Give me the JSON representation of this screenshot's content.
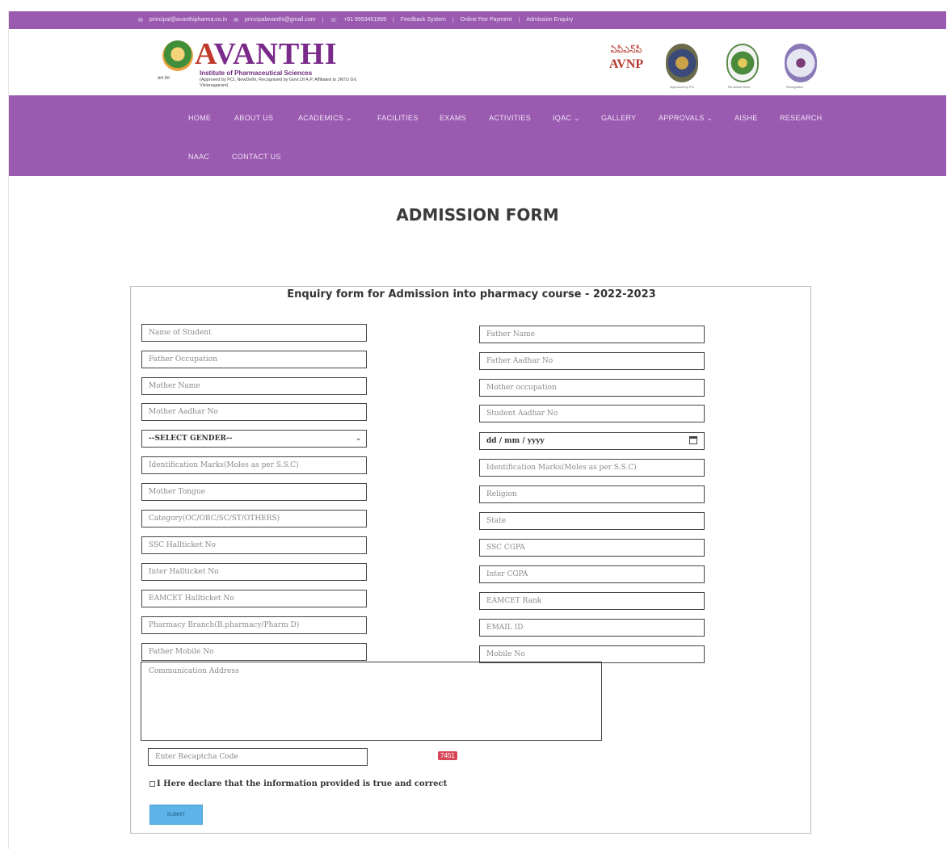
{
  "topbar": {
    "email1": "principal@avanthipharma.co.in",
    "email2": "principalavanthi@gmail.com",
    "phone": "+91 9553451999",
    "links": [
      "Feedback System",
      "Online Fee Payment",
      "Admission Enquiry"
    ]
  },
  "header": {
    "brand_first": "A",
    "brand_rest": "VANTHI",
    "subtitle": "Institute of Pharmaceutical Sciences",
    "approval": "(Approved by PCI, NewDelhi, Recognised by Govt.Of A.P, Affiliated to JNTU GV, Vizianagaram)",
    "emblem_caption": "ज्ञानं ज्ञेयं",
    "avnp_line1": "ఏవీఎన్‌పీ",
    "avnp_line2": "AVNP",
    "seal_captions": [
      "Approved by PCI",
      "Re-Active Area",
      "Recognition"
    ]
  },
  "nav": {
    "items": [
      "HOME",
      "ABOUT US",
      "ACADEMICS ⌄",
      "FACILITIES",
      "EXAMS",
      "ACTIVITIES",
      "IQAC ⌄",
      "GALLERY",
      "APPROVALS ⌄",
      "AISHE",
      "RESEARCH",
      "NAAC",
      "CONTACT US"
    ]
  },
  "page_title": "ADMISSION FORM",
  "form": {
    "heading": "Enquiry form for Admission into pharmacy course - 2022-2023",
    "left_fields": [
      "Name of Student",
      "Father Occupation",
      "Mother Name",
      "Mother Aadhar No",
      "--SELECT GENDER--",
      "Identification Marks(Moles as per S.S.C)",
      "Mother Tongue",
      "Category(OC/OBC/SC/ST/OTHERS)",
      "SSC Hallticket No",
      "Inter Hallticket No",
      "EAMCET Hallticket No",
      "Pharmacy Branch(B.pharmacy/Pharm D)",
      "Father Mobile No"
    ],
    "right_fields": [
      "Father Name",
      "Father Aadhar No",
      "Mother occupation",
      "Student Aadhar No",
      "dd / mm / yyyy",
      "Identification Marks(Moles as per S.S.C)",
      "Religion",
      "State",
      "SSC CGPA",
      "Inter CGPA",
      "EAMCET Rank",
      "EMAIL ID",
      "Mobile No"
    ],
    "address_placeholder": "Communication Address",
    "captcha_placeholder": "Enter Recaptcha Code",
    "captcha_code": "7451",
    "declaration": "I Here declare that the information provided is true and correct",
    "submit_label": "SUBMIT"
  }
}
